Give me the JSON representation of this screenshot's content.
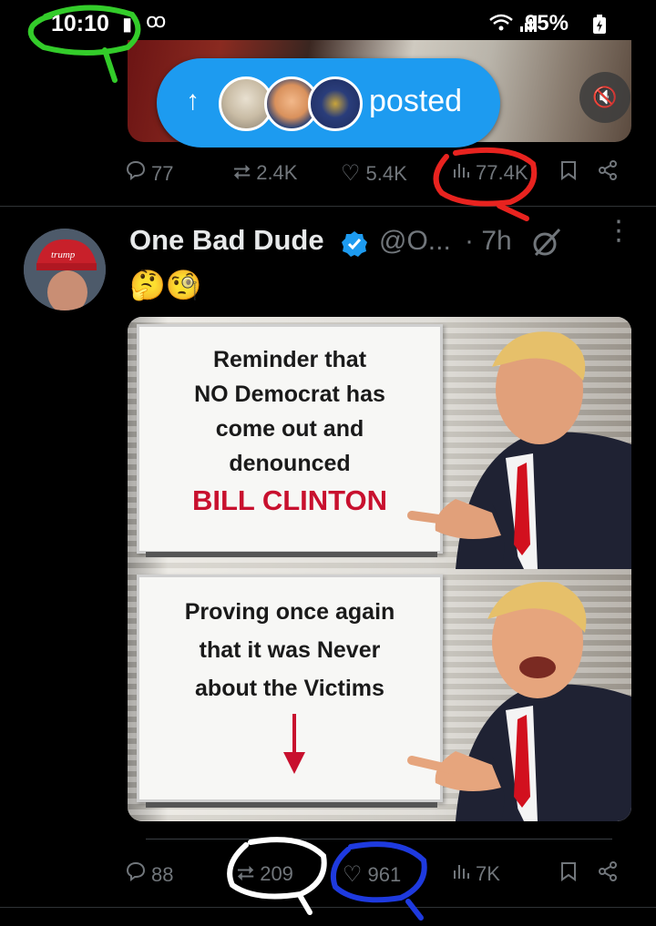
{
  "status_bar": {
    "time": "10:10",
    "battery": "95%"
  },
  "previous_tweet": {
    "posted_label": "posted",
    "actions": {
      "replies": "77",
      "reposts": "2.4K",
      "likes": "5.4K",
      "views": "77.4K"
    }
  },
  "tweet": {
    "display_name": "One Bad Dude",
    "handle": "@O...",
    "time": "· 7h",
    "emoji": "🤔🧐",
    "meme": {
      "top_lines": [
        "Reminder that",
        "NO Democrat has",
        "come out and",
        "denounced"
      ],
      "top_highlight": "BILL CLINTON",
      "bottom_lines": [
        "Proving once again",
        "that it was Never",
        "about the Victims"
      ]
    },
    "actions": {
      "replies": "88",
      "reposts": "209",
      "likes": "961",
      "views": "7K"
    }
  },
  "icons": {
    "reply": "reply-icon",
    "repost": "repost-icon",
    "like": "heart-icon",
    "views": "views-icon",
    "bookmark": "bookmark-icon",
    "share": "share-icon"
  },
  "colors": {
    "accent": "#1d9bf0",
    "background": "#000000",
    "muted": "#71767b",
    "highlight_red": "#c8102e"
  }
}
